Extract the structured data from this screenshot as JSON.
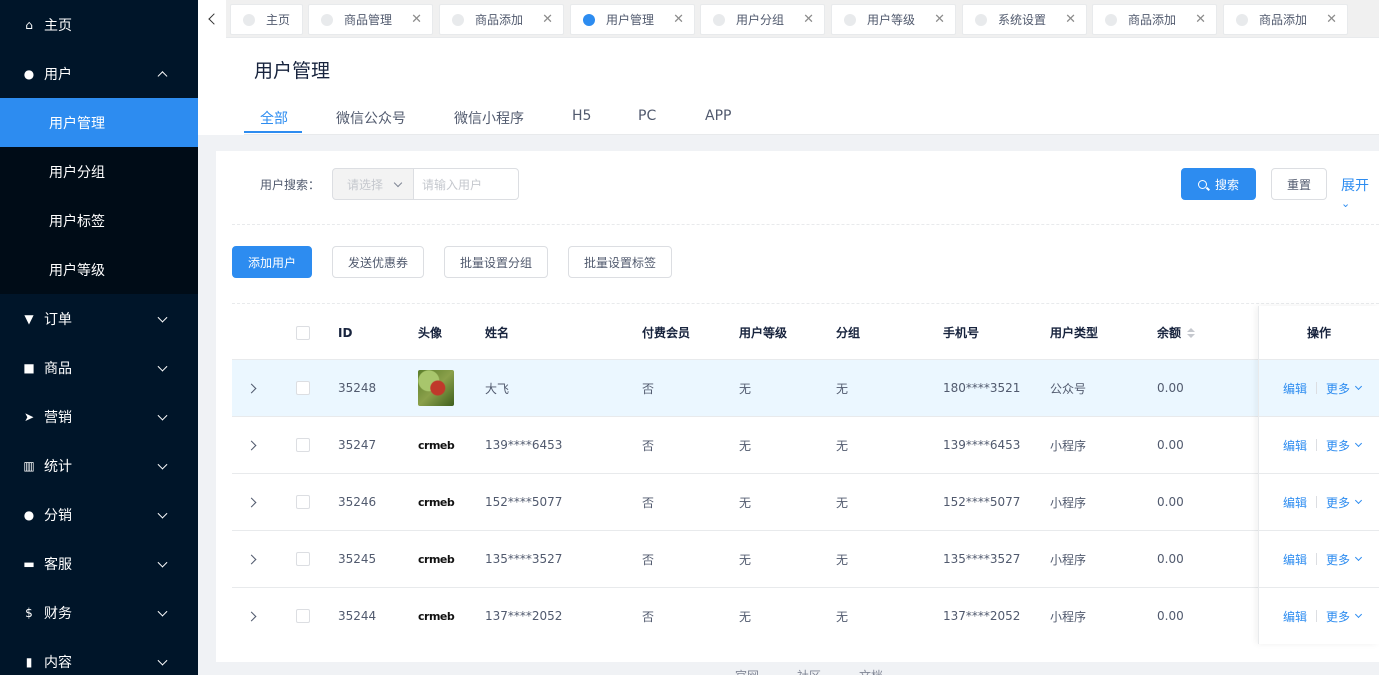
{
  "sidebar": {
    "home": "主页",
    "user": "用户",
    "user_sub": [
      "用户管理",
      "用户分组",
      "用户标签",
      "用户等级"
    ],
    "items": [
      "订单",
      "商品",
      "营销",
      "统计",
      "分销",
      "客服",
      "财务",
      "内容"
    ]
  },
  "tabs": [
    {
      "label": "主页",
      "closable": false
    },
    {
      "label": "商品管理",
      "closable": true
    },
    {
      "label": "商品添加",
      "closable": true
    },
    {
      "label": "用户管理",
      "closable": true,
      "active": true
    },
    {
      "label": "用户分组",
      "closable": true
    },
    {
      "label": "用户等级",
      "closable": true
    },
    {
      "label": "系统设置",
      "closable": true
    },
    {
      "label": "商品添加",
      "closable": true
    },
    {
      "label": "商品添加",
      "closable": true
    }
  ],
  "header": {
    "title": "用户管理",
    "subtabs": [
      "全部",
      "微信公众号",
      "微信小程序",
      "H5",
      "PC",
      "APP"
    ]
  },
  "search": {
    "label": "用户搜索：",
    "select_placeholder": "请选择",
    "input_placeholder": "请输入用户",
    "search_btn": "搜索",
    "reset_btn": "重置",
    "expand": "展开"
  },
  "actions": [
    "添加用户",
    "发送优惠券",
    "批量设置分组",
    "批量设置标签"
  ],
  "table": {
    "headers": {
      "id": "ID",
      "avatar": "头像",
      "name": "姓名",
      "paid": "付费会员",
      "level": "用户等级",
      "group": "分组",
      "phone": "手机号",
      "type": "用户类型",
      "balance": "余额",
      "ops": "操作"
    },
    "rows": [
      {
        "id": "35248",
        "avatar": "photo",
        "name": "大飞",
        "paid": "否",
        "level": "无",
        "group": "无",
        "phone": "180****3521",
        "type": "公众号",
        "balance": "0.00"
      },
      {
        "id": "35247",
        "avatar": "crmeb",
        "name": "139****6453",
        "paid": "否",
        "level": "无",
        "group": "无",
        "phone": "139****6453",
        "type": "小程序",
        "balance": "0.00"
      },
      {
        "id": "35246",
        "avatar": "crmeb",
        "name": "152****5077",
        "paid": "否",
        "level": "无",
        "group": "无",
        "phone": "152****5077",
        "type": "小程序",
        "balance": "0.00"
      },
      {
        "id": "35245",
        "avatar": "crmeb",
        "name": "135****3527",
        "paid": "否",
        "level": "无",
        "group": "无",
        "phone": "135****3527",
        "type": "小程序",
        "balance": "0.00"
      },
      {
        "id": "35244",
        "avatar": "crmeb",
        "name": "137****2052",
        "paid": "否",
        "level": "无",
        "group": "无",
        "phone": "137****2052",
        "type": "小程序",
        "balance": "0.00"
      }
    ],
    "ops": {
      "edit": "编辑",
      "more": "更多"
    },
    "logo_text": "crmeb"
  },
  "footer": [
    "官网",
    "社区",
    "文档"
  ],
  "colors": {
    "sidebar": "#001529",
    "accent": "#2d8cf0",
    "highlight_row": "#ebf7ff"
  }
}
